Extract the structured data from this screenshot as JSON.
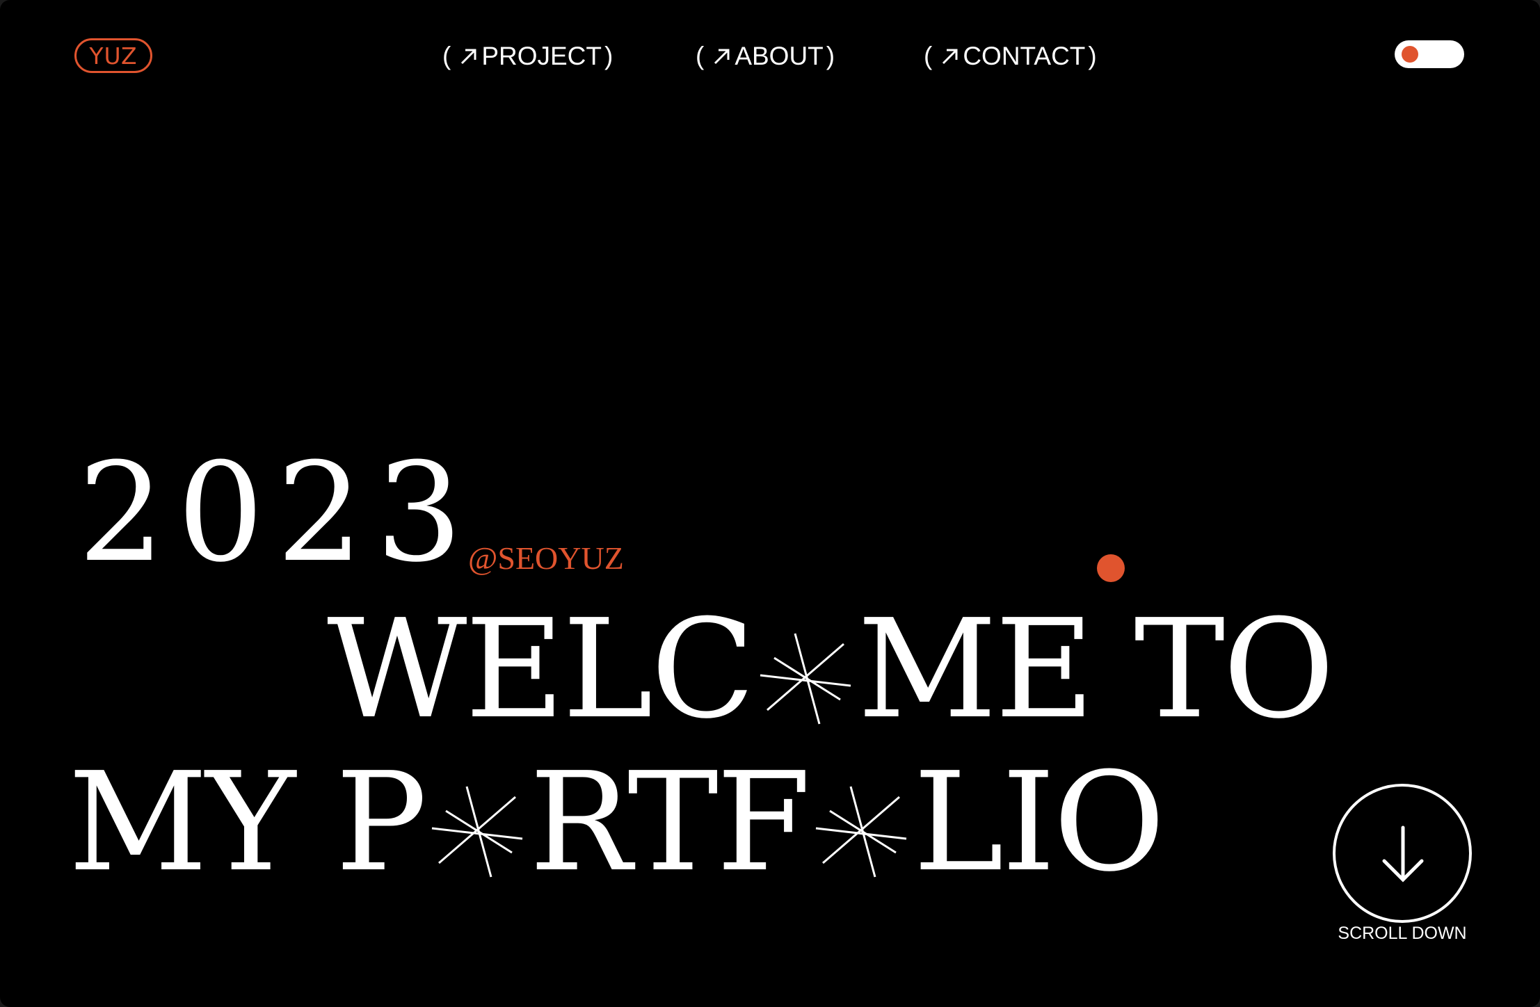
{
  "header": {
    "logo_text": "YUZ",
    "nav": [
      {
        "open": "(",
        "label": "PROJECT",
        "close": ")"
      },
      {
        "open": "(",
        "label": "ABOUT",
        "close": ")"
      },
      {
        "open": "(",
        "label": "CONTACT",
        "close": ")"
      }
    ],
    "nav_icon": "arrow-up-right-icon"
  },
  "theme_toggle": {
    "state": "on"
  },
  "hero": {
    "year": "2023",
    "handle": "@SEOYUZ",
    "line1": {
      "part1": "WELC",
      "part2": "ME",
      "part3": "TO"
    },
    "line2": {
      "part1": "MY",
      "part2": "P",
      "part3": "RTF",
      "part4": "LIO"
    },
    "star_icon": "asterisk-star-icon"
  },
  "scroll": {
    "label": "SCROLL DOWN",
    "icon": "arrow-down-icon"
  },
  "colors": {
    "accent": "#e0542e",
    "background": "#000000",
    "foreground": "#ffffff"
  }
}
